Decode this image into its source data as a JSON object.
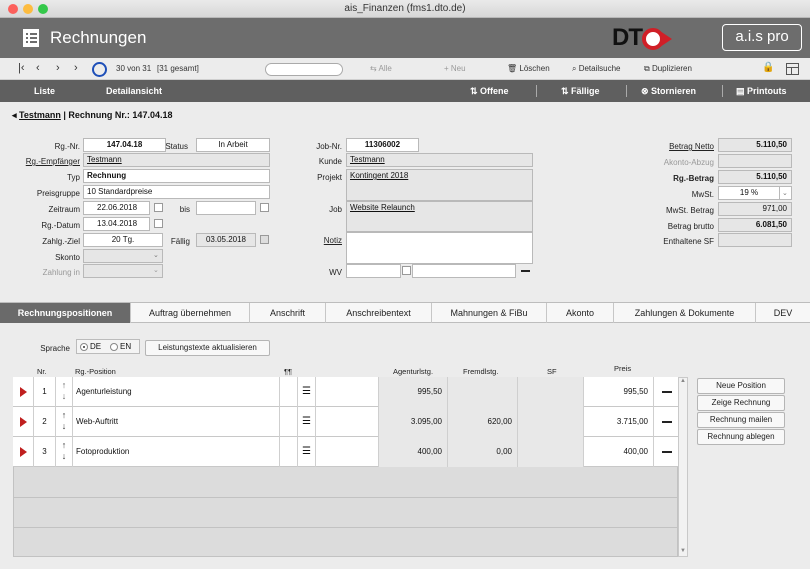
{
  "window": {
    "title": "ais_Finanzen (fms1.dto.de)"
  },
  "header": {
    "title": "Rechnungen",
    "logo_text": "DT",
    "brand": "a.i.s pro",
    "icon": "document-list-icon"
  },
  "toolbar": {
    "record_info": "30 von 31",
    "total_info": "[31 gesamt]",
    "search_placeholder": "",
    "all": "Alle",
    "new": "Neu",
    "delete": "Löschen",
    "detail_search": "Detailsuche",
    "duplicate": "Duplizieren"
  },
  "nav": {
    "list": "Liste",
    "detail": "Detailansicht",
    "open": "Offene",
    "due": "Fällige",
    "cancel": "Stornieren",
    "printouts": "Printouts"
  },
  "breadcrumb": {
    "customer": "Testmann",
    "rest": "| Rechnung Nr.: 147.04.18"
  },
  "form": {
    "rg_nr_label": "Rg.-Nr.",
    "rg_nr": "147.04.18",
    "status_label": "Status",
    "status": "In Arbeit",
    "empfaenger_label": "Rg.-Empfänger",
    "empfaenger": "Testmann",
    "typ_label": "Typ",
    "typ": "Rechnung",
    "preisgruppe_label": "Preisgruppe",
    "preisgruppe": "10 Standardpreise",
    "zeitraum_label": "Zeitraum",
    "zeitraum": "22.06.2018",
    "bis_label": "bis",
    "bis": "",
    "datum_label": "Rg.-Datum",
    "datum": "13.04.2018",
    "ziel_label": "Zahlg.-Ziel",
    "ziel": "20 Tg.",
    "faellig_label": "Fällig",
    "faellig": "03.05.2018",
    "skonto_label": "Skonto",
    "skonto": "",
    "zahlung_in_label": "Zahlung in",
    "zahlung_in": "",
    "job_nr_label": "Job-Nr.",
    "job_nr": "11306002",
    "kunde_label": "Kunde",
    "kunde": "Testmann",
    "projekt_label": "Projekt",
    "projekt": "Kontingent 2018",
    "job_label": "Job",
    "job": "Website Relaunch",
    "notiz_label": "Notiz",
    "notiz": "",
    "wv_label": "WV",
    "wv": ""
  },
  "totals": {
    "netto_label": "Betrag Netto",
    "netto": "5.110,50",
    "akonto_label": "Akonto-Abzug",
    "akonto": "",
    "rg_betrag_label": "Rg.-Betrag",
    "rg_betrag": "5.110,50",
    "mwst_label": "MwSt.",
    "mwst": "19 %",
    "mwst_betrag_label": "MwSt. Betrag",
    "mwst_betrag": "971,00",
    "brutto_label": "Betrag brutto",
    "brutto": "6.081,50",
    "sf_label": "Enthaltene SF",
    "sf": ""
  },
  "tabs": [
    "Rechnungspositionen",
    "Auftrag übernehmen",
    "Anschrift",
    "Anschreibentext",
    "Mahnungen & FiBu",
    "Akonto",
    "Zahlungen  & Dokumente",
    "DEV"
  ],
  "positions": {
    "sprache_label": "Sprache",
    "lang_de": "DE",
    "lang_en": "EN",
    "lang_selected": "DE",
    "update_texts": "Leistungstexte aktualisieren",
    "columns": {
      "nr": "Nr.",
      "position": "Rg.-Position",
      "para": "¶¶",
      "agentur": "Agenturlstg.",
      "fremd": "Fremdlstg.",
      "sf": "SF",
      "preis": "Preis"
    },
    "rows": [
      {
        "nr": "1",
        "text": "Agenturleistung",
        "agentur": "995,50",
        "fremd": "",
        "sf": "",
        "preis": "995,50"
      },
      {
        "nr": "2",
        "text": "Web-Auftritt",
        "agentur": "3.095,00",
        "fremd": "620,00",
        "sf": "",
        "preis": "3.715,00"
      },
      {
        "nr": "3",
        "text": "Fotoproduktion",
        "agentur": "400,00",
        "fremd": "0,00",
        "sf": "",
        "preis": "400,00"
      }
    ],
    "actions": [
      "Neue Position",
      "Zeige Rechnung",
      "Rechnung mailen",
      "Rechnung ablegen"
    ]
  }
}
